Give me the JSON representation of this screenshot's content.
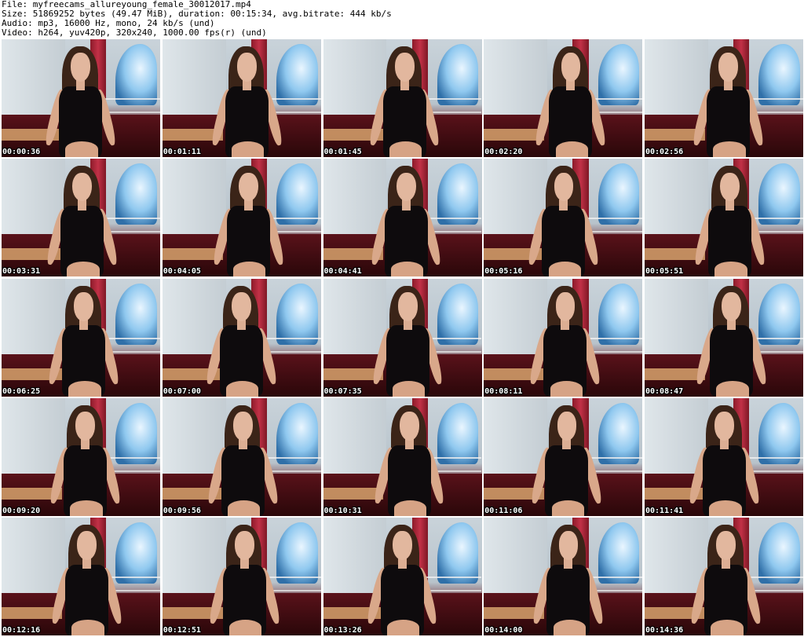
{
  "header": {
    "file_line": "File: myfreecams_allureyoung_female_30012017.mp4",
    "size_line": "Size: 51869252 bytes (49.47 MiB), duration: 00:15:34, avg.bitrate: 444 kb/s",
    "audio_line": "Audio: mp3, 16000 Hz, mono, 24 kb/s (und)",
    "video_line": "Video: h264, yuv420p, 320x240, 1000.00 fps(r) (und)"
  },
  "thumbnails": [
    {
      "time": "00:00:36"
    },
    {
      "time": "00:01:11"
    },
    {
      "time": "00:01:45"
    },
    {
      "time": "00:02:20"
    },
    {
      "time": "00:02:56"
    },
    {
      "time": "00:03:31"
    },
    {
      "time": "00:04:05"
    },
    {
      "time": "00:04:41"
    },
    {
      "time": "00:05:16"
    },
    {
      "time": "00:05:51"
    },
    {
      "time": "00:06:25"
    },
    {
      "time": "00:07:00"
    },
    {
      "time": "00:07:35"
    },
    {
      "time": "00:08:11"
    },
    {
      "time": "00:08:47"
    },
    {
      "time": "00:09:20"
    },
    {
      "time": "00:09:56"
    },
    {
      "time": "00:10:31"
    },
    {
      "time": "00:11:06"
    },
    {
      "time": "00:11:41"
    },
    {
      "time": "00:12:16"
    },
    {
      "time": "00:12:51"
    },
    {
      "time": "00:13:26"
    },
    {
      "time": "00:14:00"
    },
    {
      "time": "00:14:36"
    }
  ]
}
